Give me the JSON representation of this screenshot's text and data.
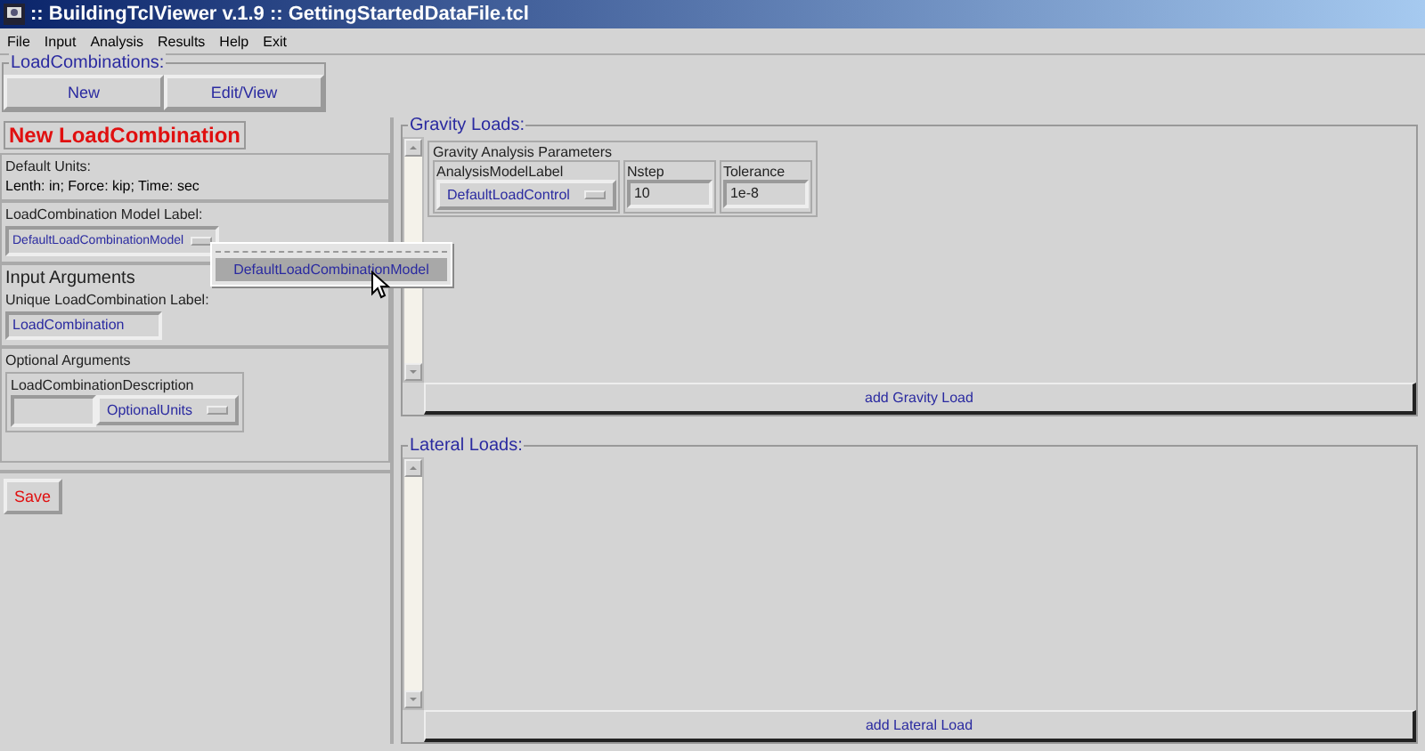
{
  "window": {
    "title": ":: BuildingTclViewer v.1.9 :: GettingStartedDataFile.tcl"
  },
  "menu": [
    "File",
    "Input",
    "Analysis",
    "Results",
    "Help",
    "Exit"
  ],
  "load_combinations": {
    "title": "LoadCombinations:",
    "buttons": [
      "New",
      "Edit/View"
    ]
  },
  "form": {
    "heading": "New LoadCombination",
    "default_units": {
      "title": "Default Units:",
      "text": "Lenth: in; Force: kip; Time: sec"
    },
    "model_label": {
      "title": "LoadCombination Model Label:",
      "value": "DefaultLoadCombinationModel",
      "expanded": true,
      "options": [
        {
          "label": "DefaultLoadCombinationModel",
          "selected": true
        }
      ]
    },
    "input_arguments": {
      "title": "Input Arguments",
      "field_title": "Unique LoadCombination Label:",
      "value": "LoadCombination"
    },
    "optional_arguments": {
      "title": "Optional Arguments",
      "group_title": "LoadCombinationDescription",
      "units": "OptionalUnits"
    },
    "save": "Save"
  },
  "gravity": {
    "title": "Gravity Loads:",
    "params_title": "Gravity Analysis Parameters",
    "params": [
      {
        "kind": "dropdown",
        "label": "AnalysisModelLabel",
        "value": "DefaultLoadControl"
      },
      {
        "kind": "field",
        "label": "Nstep",
        "value": "10"
      },
      {
        "kind": "field",
        "label": "Tolerance",
        "value": "1e-8"
      }
    ],
    "button": "add Gravity Load"
  },
  "lateral": {
    "title": "Lateral Loads:",
    "button": "add Lateral Load"
  }
}
